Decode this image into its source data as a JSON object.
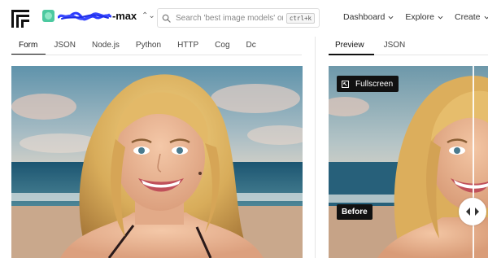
{
  "brand": {
    "model_name": "-max",
    "switch_glyph": "⌃⌄"
  },
  "search": {
    "placeholder": "Search 'best image models' or 't...",
    "shortcut": "ctrl+k"
  },
  "topnav": {
    "items": [
      {
        "label": "Dashboard"
      },
      {
        "label": "Explore"
      },
      {
        "label": "Create"
      }
    ]
  },
  "input_tabs": [
    {
      "label": "Form",
      "active": true
    },
    {
      "label": "JSON",
      "active": false
    },
    {
      "label": "Node.js",
      "active": false
    },
    {
      "label": "Python",
      "active": false
    },
    {
      "label": "HTTP",
      "active": false
    },
    {
      "label": "Cog",
      "active": false
    },
    {
      "label": "Dc",
      "active": false
    }
  ],
  "output_tabs": [
    {
      "label": "Preview",
      "active": true
    },
    {
      "label": "JSON",
      "active": false
    }
  ],
  "preview": {
    "fullscreen_label": "Fullscreen",
    "before_label": "Before"
  },
  "colors": {
    "accent": "#111111",
    "brand_icon": "#4cc9a0",
    "redaction": "#2b3bff"
  },
  "icons": {
    "logo": "replicate-logo-icon",
    "search": "search-icon",
    "chevron": "chevron-down-icon",
    "fullscreen": "fullscreen-icon",
    "compare": "compare-arrows-icon"
  }
}
